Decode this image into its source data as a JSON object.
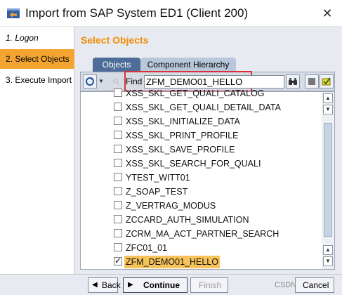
{
  "window": {
    "title": "Import from SAP System ED1 (Client 200)",
    "close_glyph": "✕",
    "icon": "sap-import-icon"
  },
  "steps": [
    {
      "label": "1. Logon",
      "active": false
    },
    {
      "label": "2. Select Objects",
      "active": true
    },
    {
      "label": "3. Execute Import",
      "active": false
    }
  ],
  "main": {
    "section_title": "Select Objects",
    "tabs": [
      {
        "label": "Objects",
        "selected": true
      },
      {
        "label": "Component Hierarchy",
        "selected": false
      }
    ],
    "toolbar": {
      "find_label": "Find",
      "find_value": "ZFM_DEMO01_HELLO"
    },
    "list_items": [
      {
        "label": "XSS_SKL_GET_QUALI_CATALOG",
        "checked": false
      },
      {
        "label": "XSS_SKL_GET_QUALI_DETAIL_DATA",
        "checked": false
      },
      {
        "label": "XSS_SKL_INITIALIZE_DATA",
        "checked": false
      },
      {
        "label": "XSS_SKL_PRINT_PROFILE",
        "checked": false
      },
      {
        "label": "XSS_SKL_SAVE_PROFILE",
        "checked": false
      },
      {
        "label": "XSS_SKL_SEARCH_FOR_QUALI",
        "checked": false
      },
      {
        "label": "YTEST_WITT01",
        "checked": false
      },
      {
        "label": "Z_SOAP_TEST",
        "checked": false
      },
      {
        "label": "Z_VERTRAG_MODUS",
        "checked": false
      },
      {
        "label": "ZCCARD_AUTH_SIMULATION",
        "checked": false
      },
      {
        "label": "ZCRM_MA_ACT_PARTNER_SEARCH",
        "checked": false
      },
      {
        "label": "ZFC01_01",
        "checked": false
      },
      {
        "label": "ZFM_DEMO01_HELLO",
        "checked": true,
        "selected": true
      }
    ]
  },
  "footer": {
    "back_label": "Back",
    "continue_label": "Continue",
    "finish_label": "Finish",
    "cancel_label": "Cancel",
    "watermark": "CSDN @...",
    "back_arrow": "◀",
    "continue_arrow": "▶"
  },
  "colors": {
    "accent": "#f08c00",
    "active_step": "#f4a531",
    "tab_active": "#4d6c97",
    "highlight": "#d9303a"
  }
}
